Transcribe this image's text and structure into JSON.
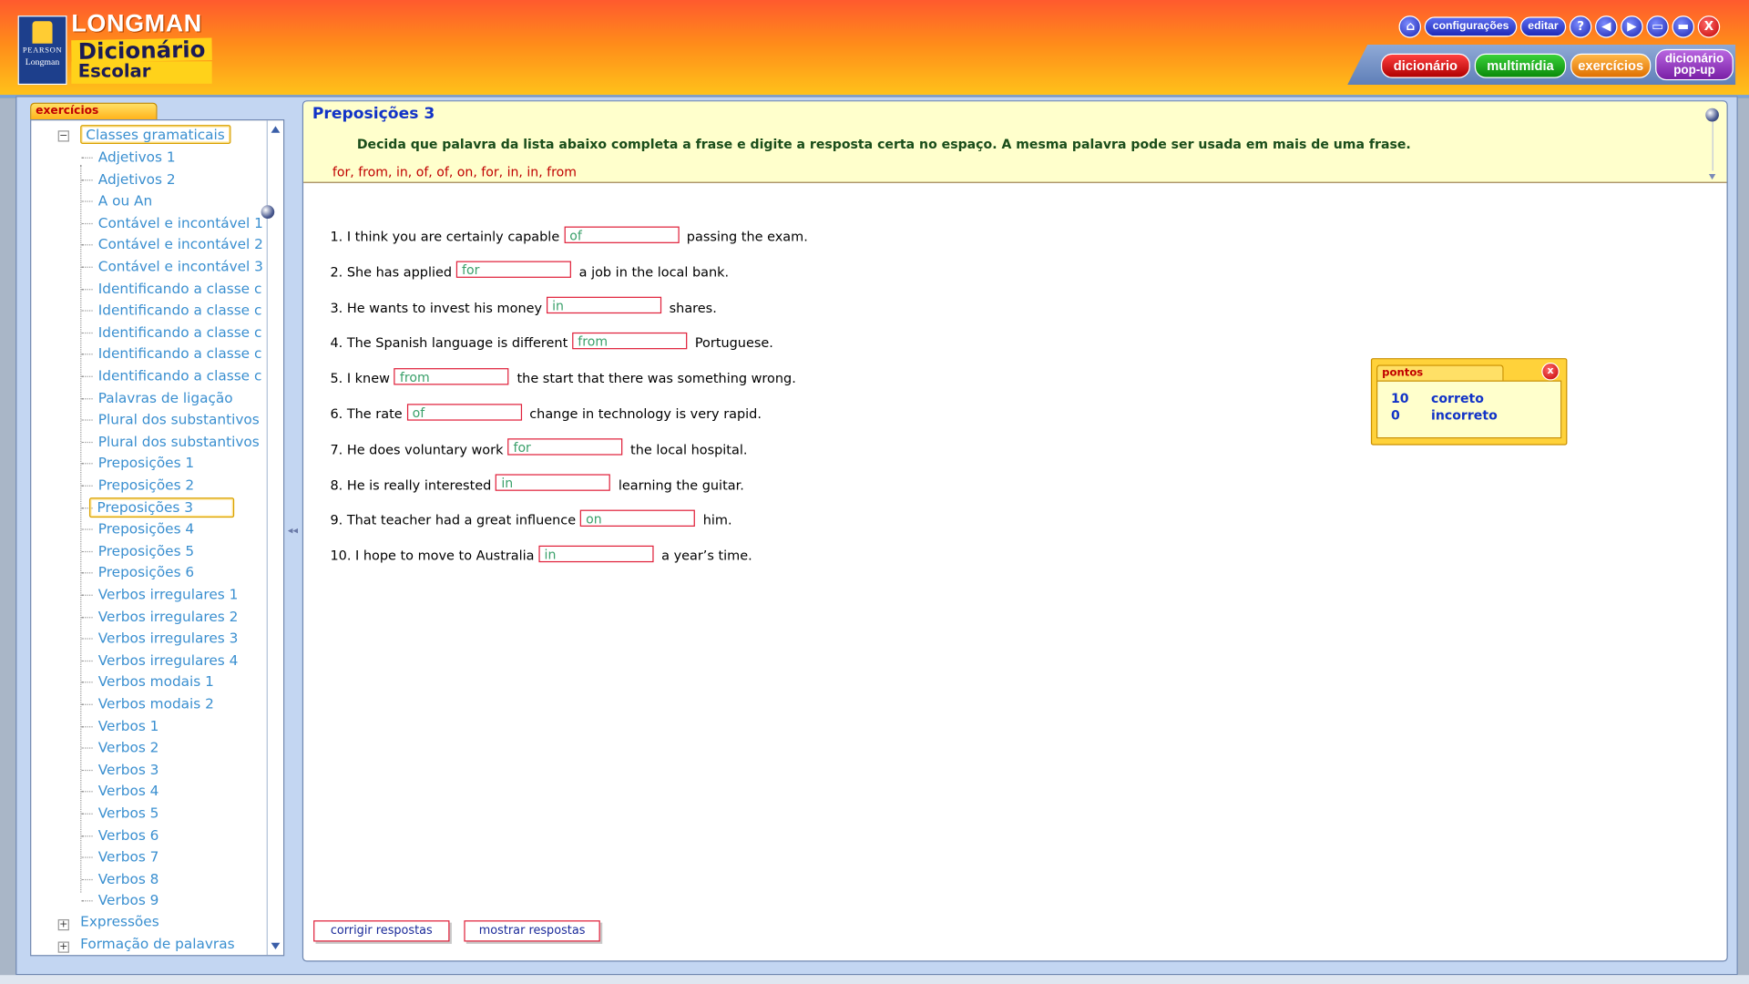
{
  "app": {
    "brand_top": "LONGMAN",
    "brand_mid": "Dicionário",
    "brand_bot": "Escolar",
    "publisher1": "PEARSON",
    "publisher2": "Longman"
  },
  "toolbar": {
    "home_icon": "home-icon",
    "configuracoes": "configurações",
    "editar": "editar",
    "help": "?",
    "back": "◀",
    "forward": "▶",
    "minimize": "▭",
    "maximize": "▬",
    "close": "X"
  },
  "tabs": {
    "dicionario": "dicionário",
    "multimidia": "multimídia",
    "exercicios": "exercícios",
    "popup_1": "dicionário",
    "popup_2": "pop-up"
  },
  "sidebar": {
    "tab_label": "exercícios",
    "category_open": "Classes gramaticais",
    "items": [
      "Adjetivos 1",
      "Adjetivos 2",
      "A ou An",
      "Contável e incontável 1",
      "Contável e incontável 2",
      "Contável e incontável 3",
      "Identificando a classe c",
      "Identificando a classe c",
      "Identificando a classe c",
      "Identificando a classe c",
      "Identificando a classe c",
      "Palavras de ligação",
      "Plural dos substantivos",
      "Plural dos substantivos",
      "Preposições 1",
      "Preposições 2",
      "Preposições 3",
      "Preposições 4",
      "Preposições 5",
      "Preposições 6",
      "Verbos irregulares 1",
      "Verbos irregulares 2",
      "Verbos irregulares 3",
      "Verbos irregulares 4",
      "Verbos modais 1",
      "Verbos modais 2",
      "Verbos 1",
      "Verbos 2",
      "Verbos 3",
      "Verbos 4",
      "Verbos 5",
      "Verbos 6",
      "Verbos 7",
      "Verbos 8",
      "Verbos 9"
    ],
    "selected_item": "Preposições 3",
    "category_2": "Expressões",
    "category_3": "Formação de palavras"
  },
  "exercise": {
    "title": "Preposições 3",
    "instructions": "Decida que palavra da lista abaixo completa a frase e digite a resposta certa no espaço. A mesma palavra pode ser usada em mais de uma frase.",
    "word_list": "for, from, in, of, of, on, for, in, in, from",
    "questions": [
      {
        "before": "1. I think you are certainly capable",
        "answer": "of",
        "after": "passing the exam."
      },
      {
        "before": "2. She has applied",
        "answer": "for",
        "after": "a job in the local bank."
      },
      {
        "before": "3. He wants to invest his money",
        "answer": "in",
        "after": "shares."
      },
      {
        "before": "4. The Spanish language is different",
        "answer": "from",
        "after": "Portuguese."
      },
      {
        "before": "5. I knew",
        "answer": "from",
        "after": "the start that there was something wrong."
      },
      {
        "before": "6. The rate",
        "answer": "of",
        "after": "change in technology is very rapid."
      },
      {
        "before": "7. He does voluntary work",
        "answer": "for",
        "after": "the local hospital."
      },
      {
        "before": "8. He is really interested",
        "answer": "in",
        "after": "learning the guitar."
      },
      {
        "before": "9. That teacher had a great influence",
        "answer": "on",
        "after": "him."
      },
      {
        "before": "10. I hope to move to Australia",
        "answer": "in",
        "after": "a year’s time."
      }
    ],
    "check_button": "corrigir respostas",
    "show_button": "mostrar respostas"
  },
  "score": {
    "tab_label": "pontos",
    "close": "x",
    "correct_count": "10",
    "correct_label": "correto",
    "incorrect_count": "0",
    "incorrect_label": "incorreto"
  },
  "colors": {
    "header_top": "#ff5a2e",
    "header_bottom": "#ffc51a",
    "title_blue": "#1233c7",
    "answer_border": "#e0203a",
    "answer_text": "#3aa06a",
    "tree_text": "#3a8fd0"
  }
}
